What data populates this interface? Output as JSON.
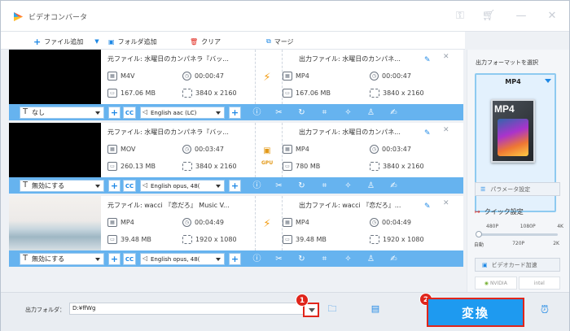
{
  "app": {
    "title": "ビデオコンバータ"
  },
  "toolbar": {
    "add_file": "ファイル追加",
    "add_folder": "フォルダ追加",
    "clear": "クリア",
    "merge": "マージ"
  },
  "rows": [
    {
      "src_title": "元ファイル: 水曜日のカンパネラ『バッ...",
      "src_format": "M4V",
      "src_duration": "00:00:47",
      "src_size": "167.06 MB",
      "src_res": "3840 x 2160",
      "out_title": "出力ファイル: 水曜日のカンパネ...",
      "out_format": "MP4",
      "out_duration": "00:00:47",
      "out_size": "167.06 MB",
      "out_res": "3840 x 2160",
      "subtitle": "なし",
      "audio": "English aac (LC)",
      "gpu": ""
    },
    {
      "src_title": "元ファイル: 水曜日のカンパネラ『バッ...",
      "src_format": "MOV",
      "src_duration": "00:03:47",
      "src_size": "260.13 MB",
      "src_res": "3840 x 2160",
      "out_title": "出力ファイル: 水曜日のカンパネ...",
      "out_format": "MP4",
      "out_duration": "00:03:47",
      "out_size": "780 MB",
      "out_res": "3840 x 2160",
      "subtitle": "無効にする",
      "audio": "English opus, 48(",
      "gpu": "GPU"
    },
    {
      "src_title": "元ファイル: wacci 『恋だろ』 Music V...",
      "src_format": "MP4",
      "src_duration": "00:04:49",
      "src_size": "39.48 MB",
      "src_res": "1920 x 1080",
      "out_title": "出力ファイル: wacci 『恋だろ』...",
      "out_format": "MP4",
      "out_duration": "00:04:49",
      "out_size": "39.48 MB",
      "out_res": "1920 x 1080",
      "subtitle": "無効にする",
      "audio": "English opus, 48(",
      "gpu": ""
    }
  ],
  "right_panel": {
    "output_format_label": "出力フォーマットを選択",
    "selected_format": "MP4",
    "icon_text": "MP4",
    "param_button": "パラメータ設定",
    "quality_title": "クイック設定",
    "quality_top_ticks": [
      "480P",
      "1080P",
      "4K"
    ],
    "quality_bottom_ticks": [
      "自動",
      "720P",
      "2K"
    ],
    "quality_level": 0,
    "gpu_button": "ビデオカード加速",
    "gpu_vendors": [
      "NVIDIA",
      "intel"
    ]
  },
  "bottom": {
    "output_folder_label": "出力フォルダ：",
    "output_folder_value": "D:¥ffWg",
    "badge1": "1",
    "badge2": "2",
    "convert_label": "変換"
  },
  "colors": {
    "accent": "#1e88e5",
    "control_bar": "#66b3ef",
    "highlight": "#e0251b",
    "bolt": "#f39c12"
  }
}
